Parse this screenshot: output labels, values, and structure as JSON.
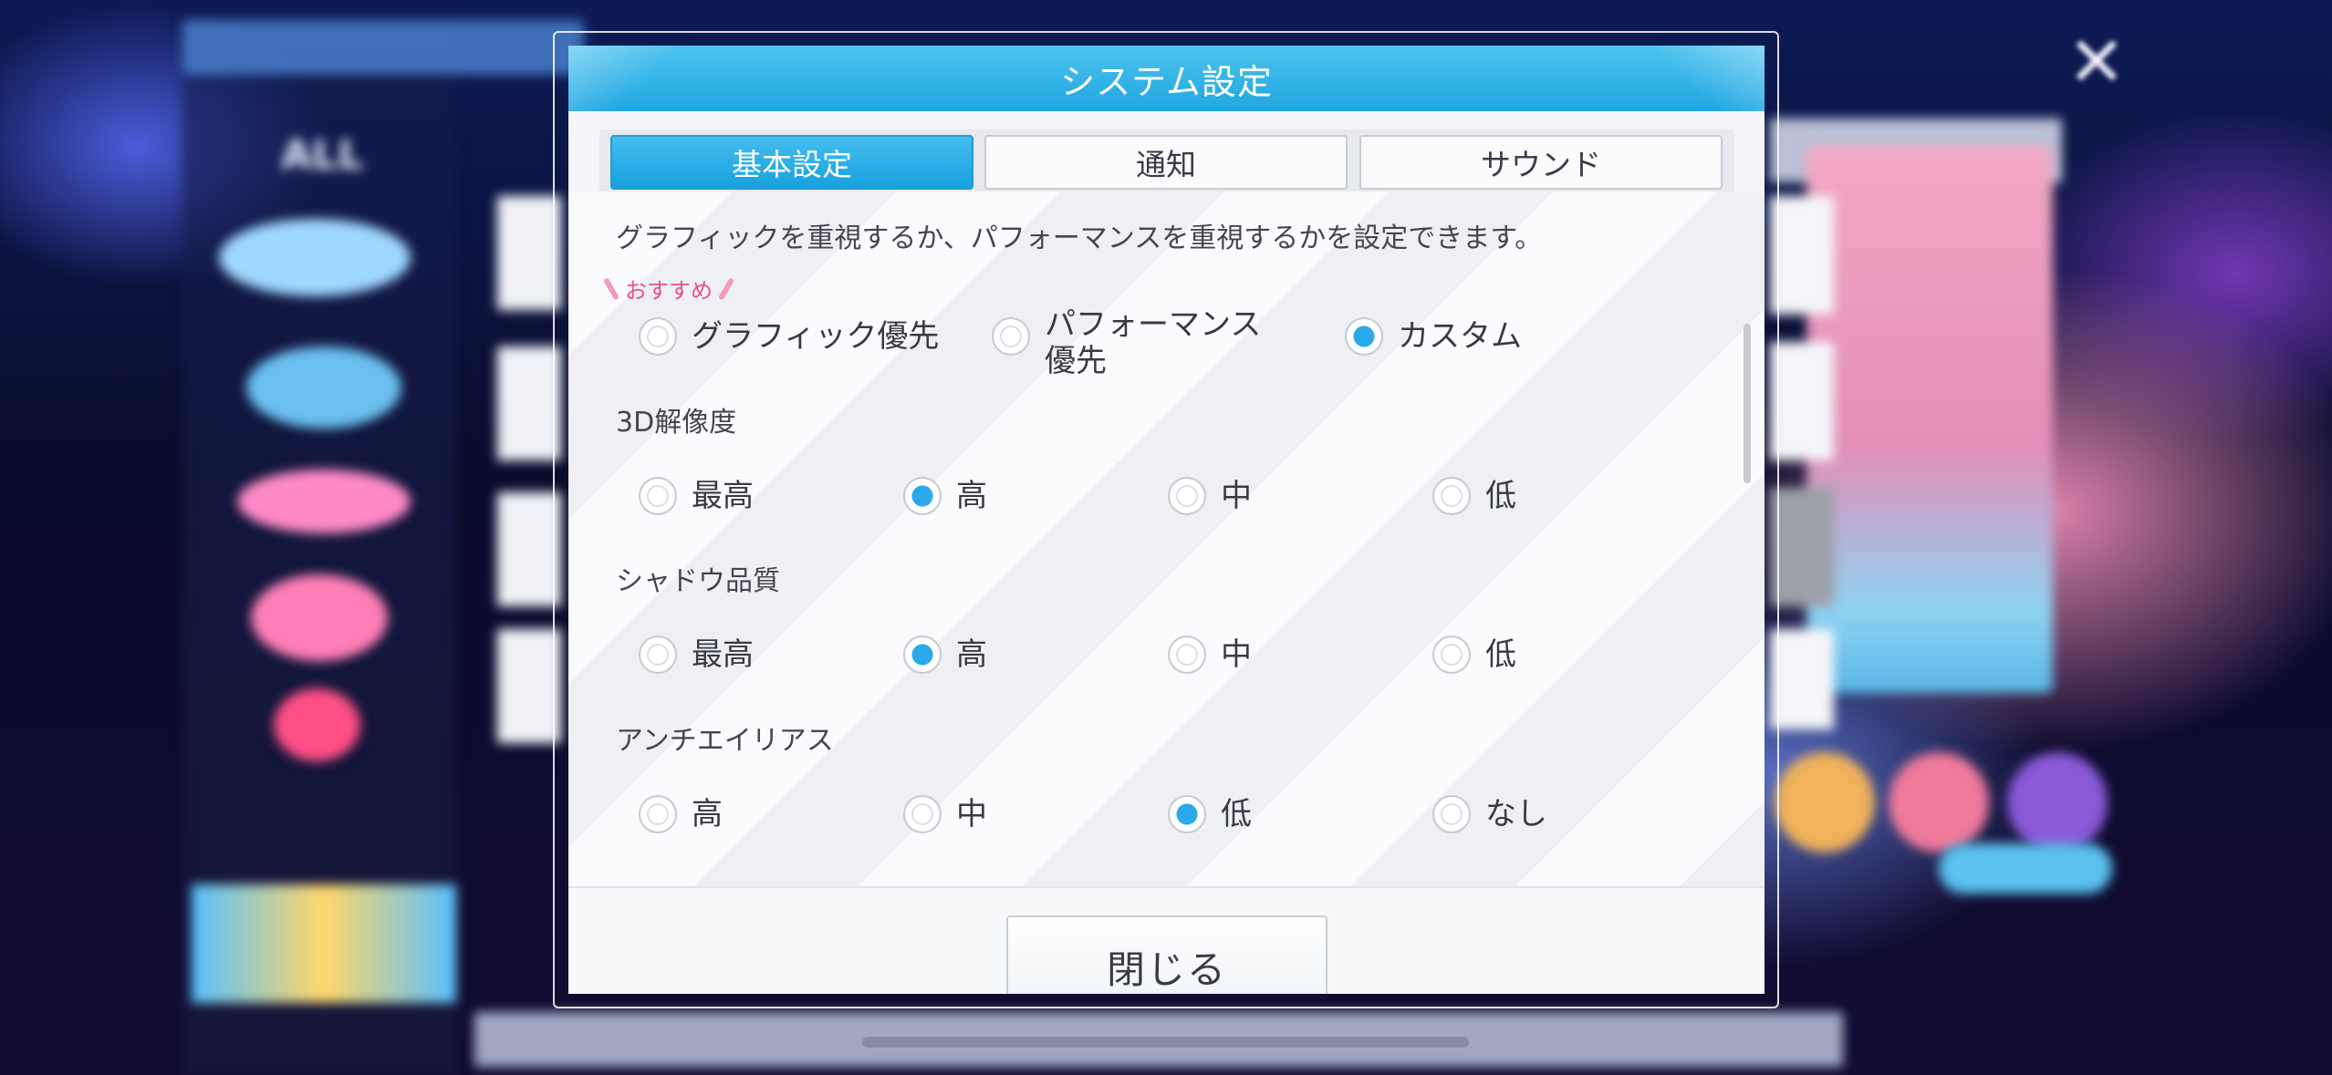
{
  "dialog": {
    "title": "システム設定",
    "tabs": [
      {
        "label": "基本設定",
        "active": true
      },
      {
        "label": "通知",
        "active": false
      },
      {
        "label": "サウンド",
        "active": false
      }
    ],
    "description": "グラフィックを重視するか、パフォーマンスを重視するかを設定できます。",
    "preset": {
      "recommended_badge": "おすすめ",
      "options": [
        "グラフィック優先",
        "パフォーマンス\n優先",
        "カスタム"
      ],
      "selected": "カスタム"
    },
    "resolution_3d": {
      "label": "3D解像度",
      "options": [
        "最高",
        "高",
        "中",
        "低"
      ],
      "selected": "高"
    },
    "shadow_quality": {
      "label": "シャドウ品質",
      "options": [
        "最高",
        "高",
        "中",
        "低"
      ],
      "selected": "高"
    },
    "anti_aliasing": {
      "label": "アンチエイリアス",
      "options": [
        "高",
        "中",
        "低",
        "なし"
      ],
      "selected": "低"
    },
    "close_label": "閉じる"
  },
  "background": {
    "side_label": "ALL",
    "close_icon": "sparkle-close-icon"
  },
  "colors": {
    "accent": "#1fa6e0",
    "radio_selected": "#2aa9ea",
    "recommend": "#ec4e8a"
  }
}
